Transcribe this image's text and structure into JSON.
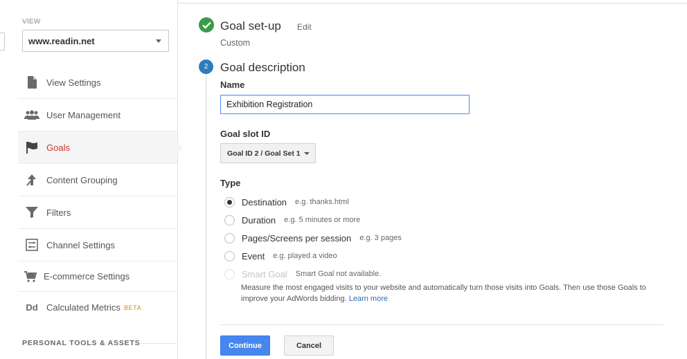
{
  "sidebar": {
    "view_label": "VIEW",
    "view_value": "www.readin.net",
    "items": [
      {
        "label": "View Settings",
        "icon": "document-icon"
      },
      {
        "label": "User Management",
        "icon": "users-icon"
      },
      {
        "label": "Goals",
        "icon": "flag-icon",
        "active": true
      },
      {
        "label": "Content Grouping",
        "icon": "content-grouping-icon"
      },
      {
        "label": "Filters",
        "icon": "filter-icon"
      },
      {
        "label": "Channel Settings",
        "icon": "channel-settings-icon"
      },
      {
        "label": "E-commerce Settings",
        "icon": "cart-icon"
      },
      {
        "label": "Calculated Metrics",
        "icon": "dd-icon",
        "badge": "BETA"
      }
    ],
    "tools_label": "PERSONAL TOOLS & ASSETS"
  },
  "step1": {
    "title": "Goal set-up",
    "edit": "Edit",
    "subtitle": "Custom"
  },
  "step2": {
    "number": "2",
    "title": "Goal description",
    "name_label": "Name",
    "name_value": "Exhibition Registration",
    "slot_label": "Goal slot ID",
    "slot_value": "Goal ID 2 / Goal Set 1",
    "type_label": "Type",
    "types": [
      {
        "label": "Destination",
        "hint": "e.g. thanks.html",
        "selected": true
      },
      {
        "label": "Duration",
        "hint": "e.g. 5 minutes or more"
      },
      {
        "label": "Pages/Screens per session",
        "hint": "e.g. 3 pages"
      },
      {
        "label": "Event",
        "hint": "e.g. played a video"
      },
      {
        "label": "Smart Goal",
        "hint": "Smart Goal not available.",
        "disabled": true
      }
    ],
    "smart_desc": "Measure the most engaged visits to your website and automatically turn those visits into Goals. Then use those Goals to improve your AdWords bidding.",
    "learn_more": "Learn more",
    "continue": "Continue",
    "cancel": "Cancel"
  },
  "colors": {
    "active_nav": "#c8362b",
    "check_green": "#3b9b47",
    "step_blue": "#2f7bbf",
    "primary_button": "#4787ed",
    "beta": "#e0801f",
    "link": "#2a6ebb"
  }
}
